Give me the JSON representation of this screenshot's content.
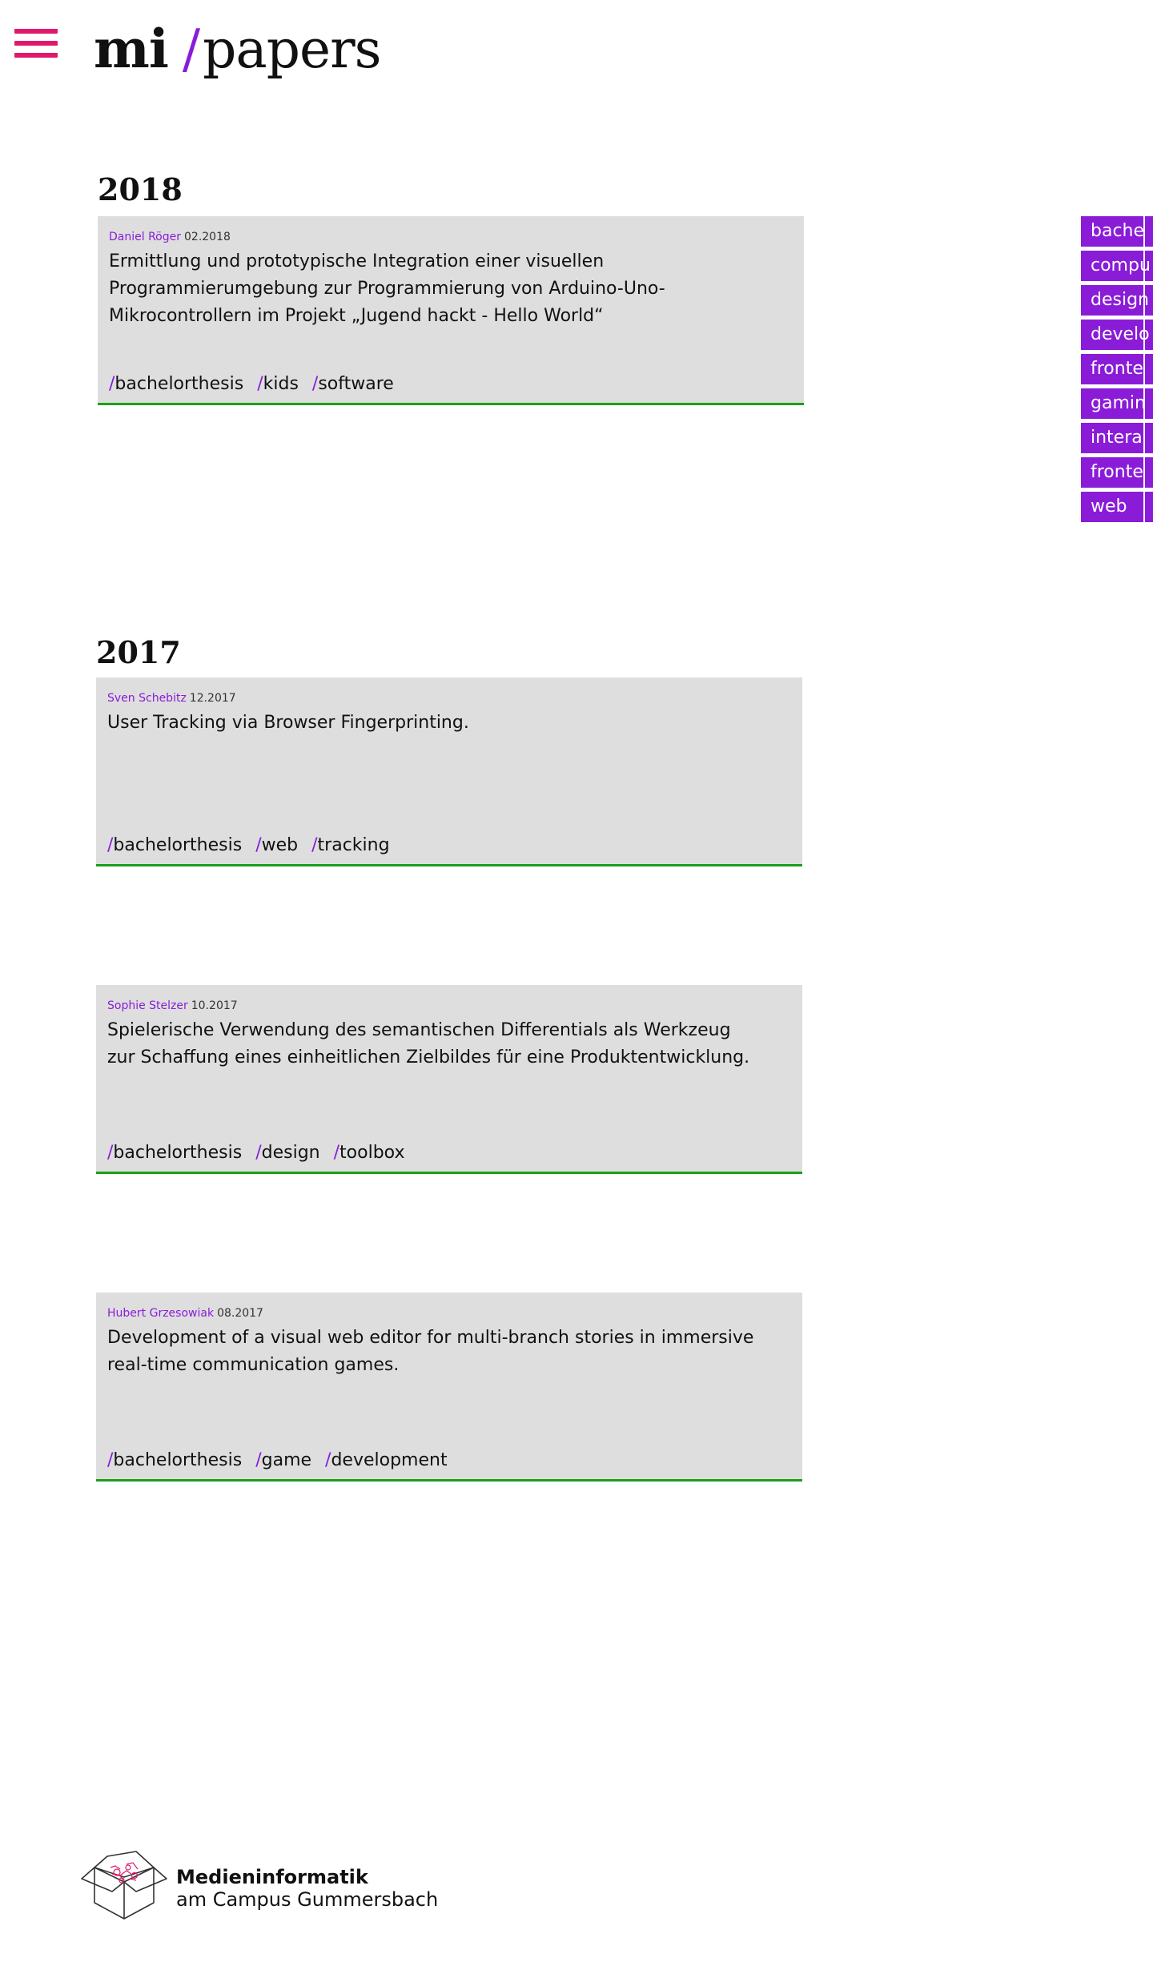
{
  "header": {
    "logo_mi": "mi",
    "logo_slash": "/",
    "logo_papers": "papers",
    "accent_color": "#8a1cd8",
    "menu_color": "#e0186c",
    "menu_icon": "hamburger-menu-icon"
  },
  "sections": [
    {
      "year": "2018",
      "papers": [
        {
          "author": "Daniel Röger",
          "date": "02.2018",
          "title": "Ermittlung und prototypische Integration einer visuellen Programmierumgebung zur Programmierung von Arduino-Uno-Mikrocontrollern im Projekt „Jugend hackt - Hello World“",
          "tags": [
            "bachelorthesis",
            "kids",
            "software"
          ]
        }
      ]
    },
    {
      "year": "2017",
      "papers": [
        {
          "author": "Sven Schebitz",
          "date": "12.2017",
          "title": "User Tracking via Browser Fingerprinting.",
          "tags": [
            "bachelorthesis",
            "web",
            "tracking"
          ]
        },
        {
          "author": "Sophie Stelzer",
          "date": "10.2017",
          "title": "Spielerische Verwendung des semantischen Differentials als Werkzeug zur Schaffung eines einheitlichen Zielbildes für eine Produktentwicklung.",
          "tags": [
            "bachelorthesis",
            "design",
            "toolbox"
          ]
        },
        {
          "author": "Hubert Grzesowiak",
          "date": "08.2017",
          "title": "Development of a visual web editor for multi-branch stories in immersive real-time communication games.",
          "tags": [
            "bachelorthesis",
            "game",
            "development"
          ]
        }
      ]
    }
  ],
  "tag_slash": "/",
  "filters": [
    "bache",
    "compu",
    "design",
    "develo",
    "fronte",
    "gamin",
    "intera",
    "fronte",
    "web"
  ],
  "footer": {
    "line1": "Medieninformatik",
    "line2": "am Campus Gummersbach",
    "logo_icon": "box-logo-icon"
  },
  "colors": {
    "card_background": "#dedede",
    "card_border": "#1aa01a",
    "filter_background": "#8a1cd8"
  }
}
